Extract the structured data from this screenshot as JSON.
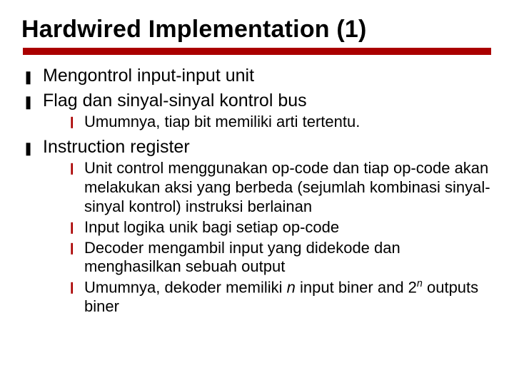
{
  "slide": {
    "title": "Hardwired Implementation (1)",
    "bullets": [
      {
        "text": "Mengontrol input-input unit",
        "children": []
      },
      {
        "text": "Flag dan sinyal-sinyal kontrol bus",
        "children": [
          {
            "text": "Umumnya, tiap bit memiliki arti tertentu."
          }
        ]
      },
      {
        "text": "Instruction register",
        "children": [
          {
            "text": "Unit control menggunakan op-code dan tiap op-code akan melakukan aksi yang berbeda (sejumlah kombinasi sinyal-sinyal kontrol) instruksi berlainan"
          },
          {
            "text": "Input logika unik bagi setiap op-code"
          },
          {
            "text": "Decoder mengambil input yang didekode dan menghasilkan sebuah output"
          },
          {
            "text_prefix": "Umumnya, dekoder memiliki ",
            "n_var": "n",
            "text_mid": " input biner and 2",
            "exp_var": "n",
            "text_suffix": " outputs biner"
          }
        ]
      }
    ],
    "glyphs": {
      "l1": "❚",
      "l2": "❙"
    }
  }
}
